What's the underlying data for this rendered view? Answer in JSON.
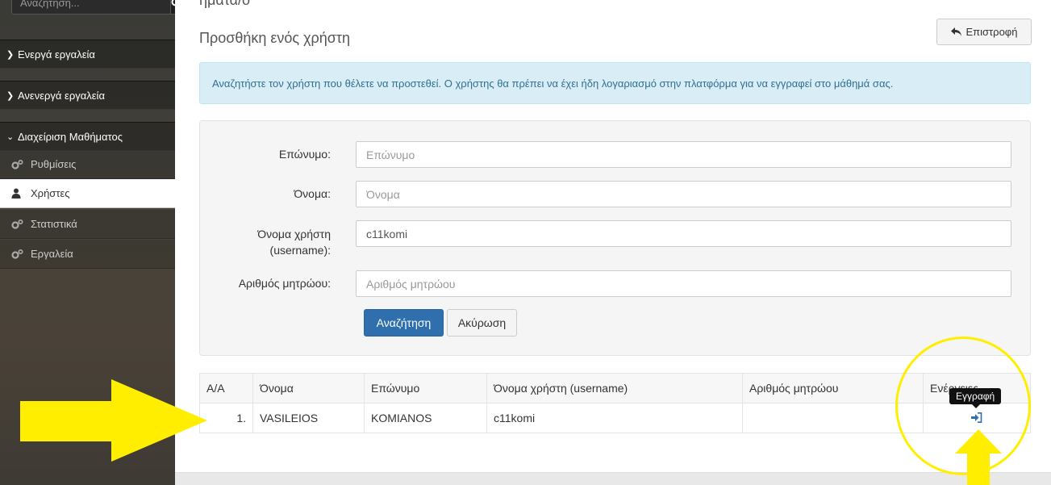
{
  "sidebar": {
    "search_placeholder": "Αναζήτηση...",
    "sections": [
      {
        "label": "Ενεργά εργαλεία",
        "icon": "chevron-right-icon"
      },
      {
        "label": "Ανενεργά εργαλεία",
        "icon": "chevron-right-icon"
      },
      {
        "label": "Διαχείριση Μαθήματος",
        "icon": "chevron-down-icon"
      }
    ],
    "items": [
      {
        "label": "Ρυθμίσεις",
        "icon": "gears-icon"
      },
      {
        "label": "Χρήστες",
        "icon": "user-icon"
      },
      {
        "label": "Στατιστικά",
        "icon": "gears-icon"
      },
      {
        "label": "Εργαλεία",
        "icon": "gears-icon"
      }
    ]
  },
  "main": {
    "top_cut_text": "ήματα/ο",
    "title": "Προσθήκη ενός χρήστη",
    "back_label": "Επιστροφή",
    "alert": "Αναζητήστε τον χρήστη που θέλετε να προστεθεί. Ο χρήστης θα πρέπει να έχει ήδη λογαριασμό στην πλατφόρμα για να εγγραφεί στο μάθημά σας.",
    "form": {
      "surname_label": "Επώνυμο:",
      "surname_placeholder": "Επώνυμο",
      "name_label": "Όνομα:",
      "name_placeholder": "Όνομα",
      "username_label_1": "Όνομα χρήστη",
      "username_label_2": "(username):",
      "username_value": "c11komi",
      "am_label": "Αριθμός μητρώου:",
      "am_placeholder": "Αριθμός μητρώου",
      "search_label": "Αναζήτηση",
      "cancel_label": "Ακύρωση"
    },
    "table": {
      "headers": [
        "Α/Α",
        "Όνομα",
        "Επώνυμο",
        "Όνομα χρήστη (username)",
        "Αριθμός μητρώου",
        "Ενέργειες"
      ],
      "rows": [
        {
          "aa": "1.",
          "name": "VASILEIOS",
          "surname": "KOMIANOS",
          "username": "c11komi",
          "am": ""
        }
      ]
    },
    "tooltip": "Εγγραφή"
  },
  "colors": {
    "primary": "#2f6fad",
    "alert_bg": "#d9edf7",
    "alert_text": "#31708f",
    "annotation": "#ffee00"
  }
}
